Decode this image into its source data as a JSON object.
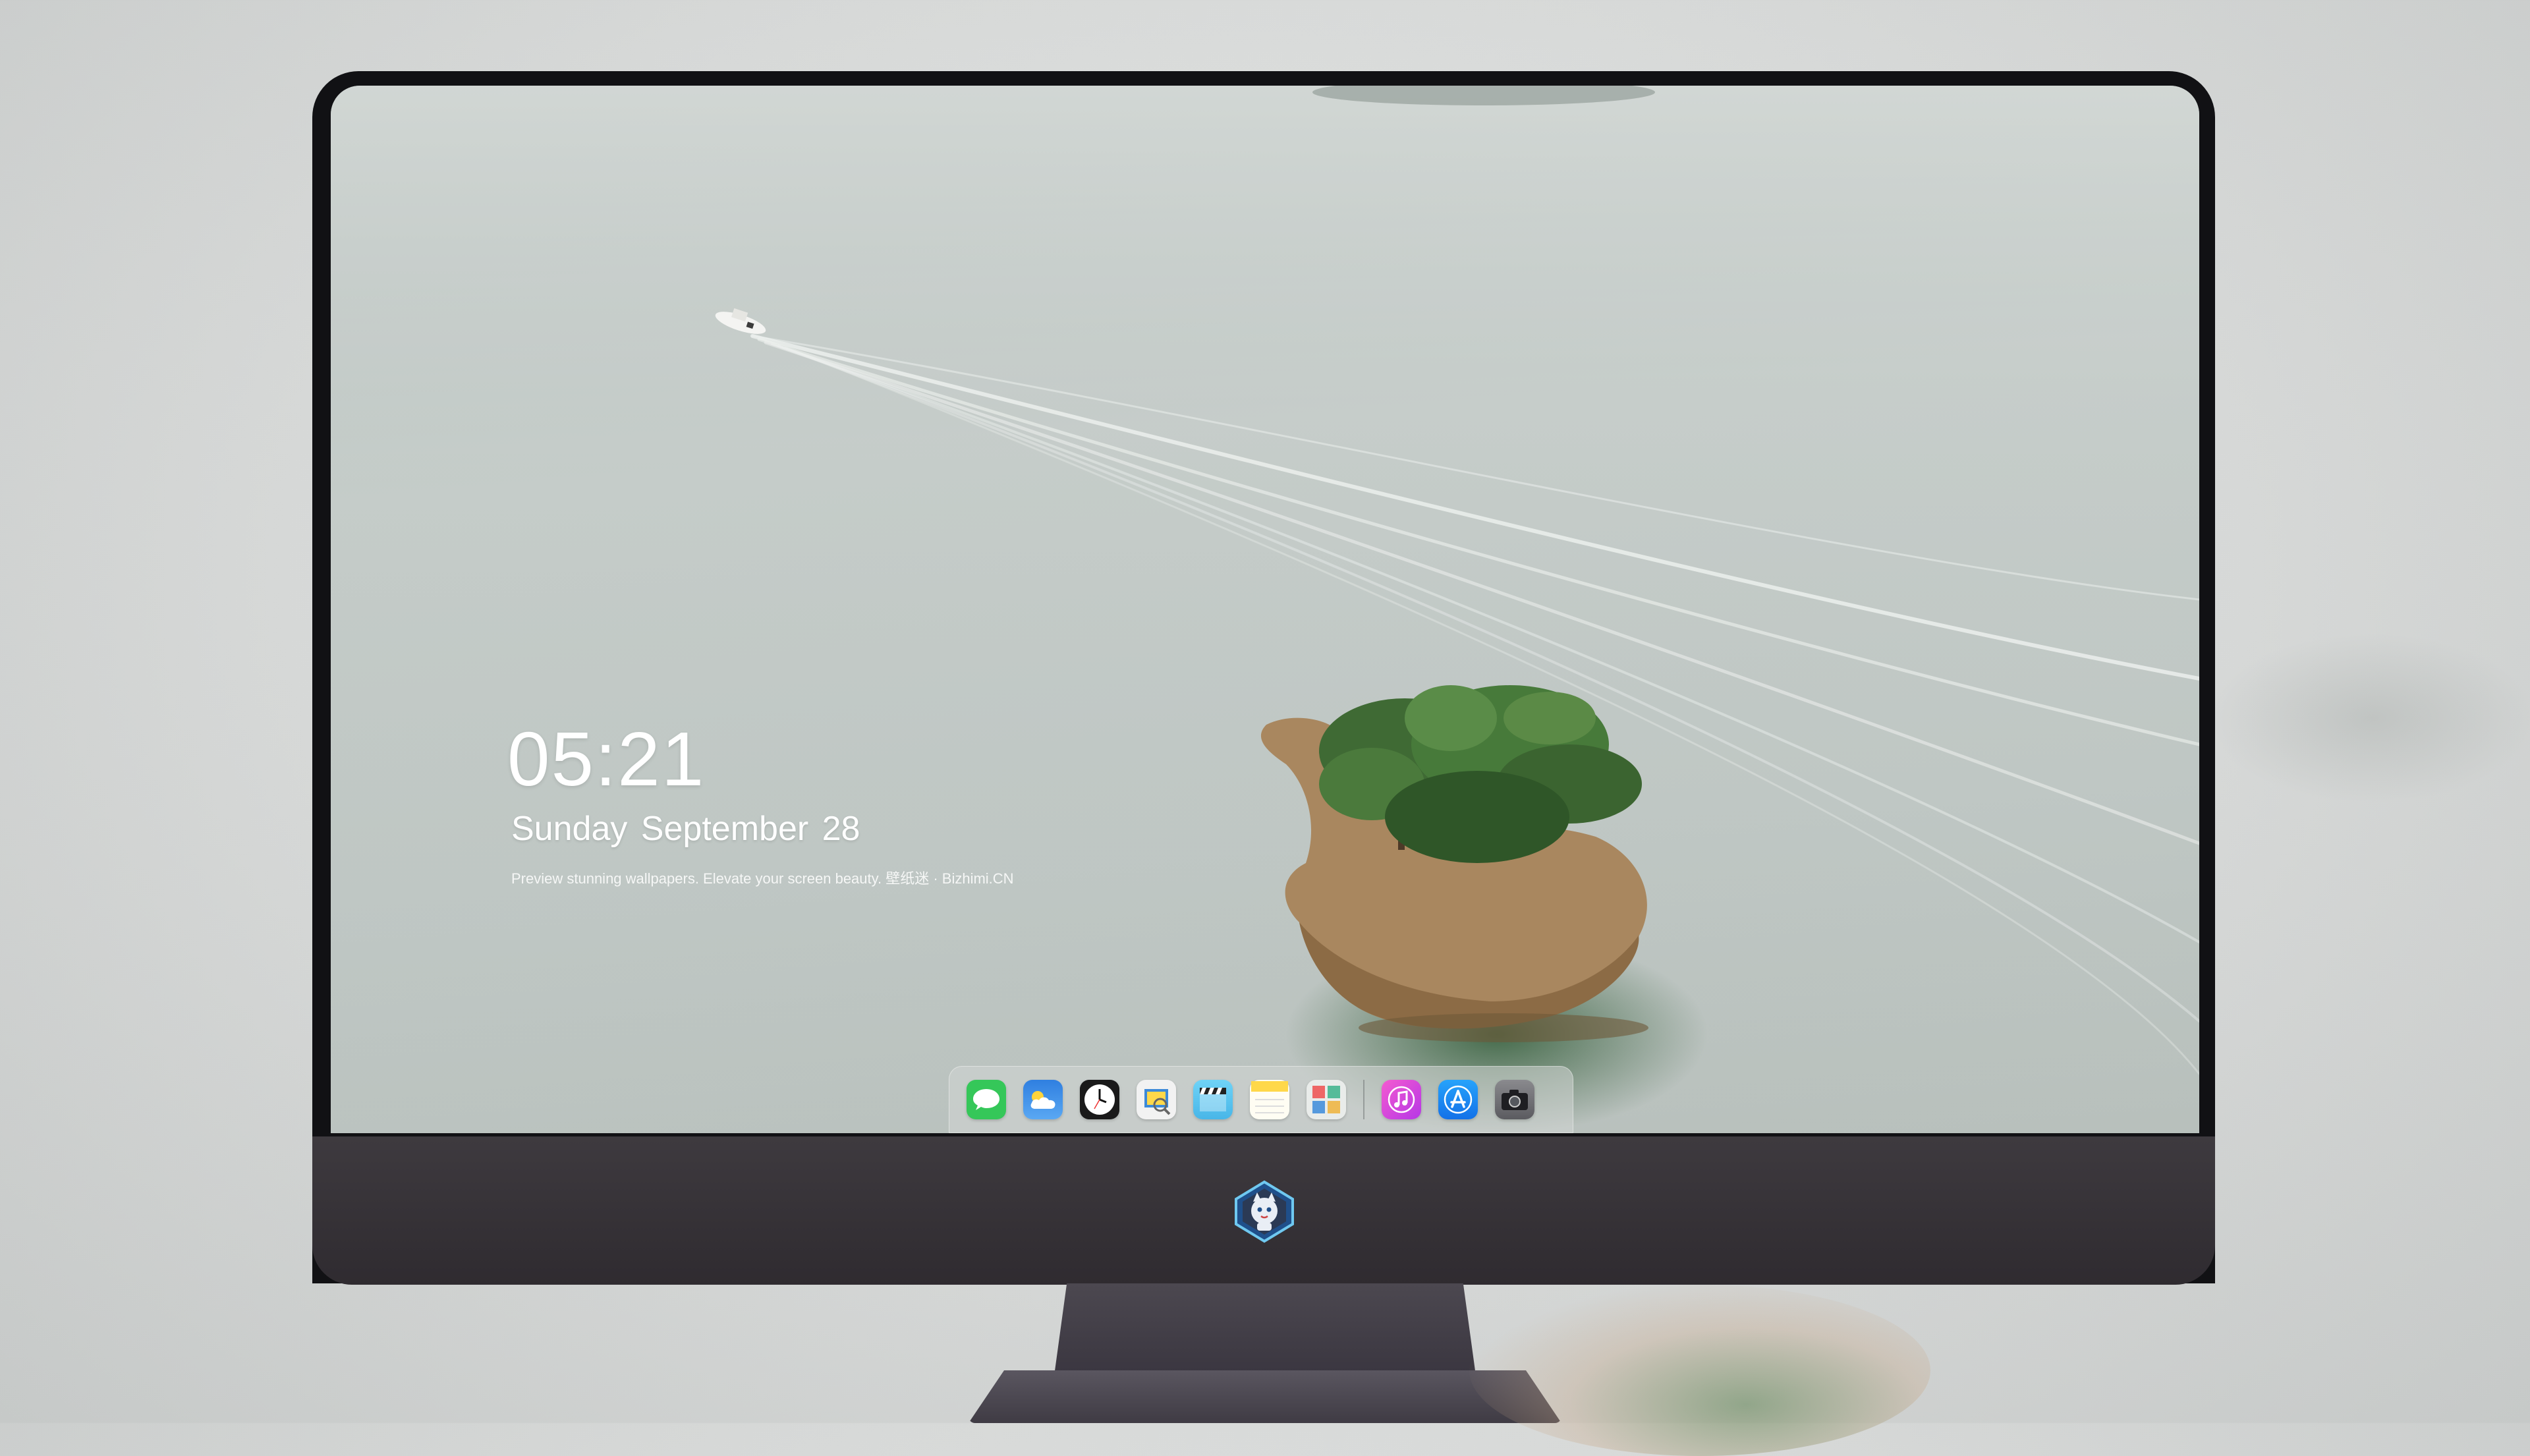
{
  "lockscreen": {
    "time": "05:21",
    "date": "Sunday September  28",
    "tagline": "Preview stunning wallpapers. Elevate your screen beauty. 壁纸迷 · Bizhimi.CN"
  },
  "dock": {
    "apps": [
      {
        "name": "Messages",
        "icon": "messages-icon",
        "color": "#35c759"
      },
      {
        "name": "Weather",
        "icon": "weather-icon",
        "color": "#3b8fe8"
      },
      {
        "name": "Clock",
        "icon": "clock-icon",
        "color": "#1a1a1a"
      },
      {
        "name": "Preview",
        "icon": "preview-icon",
        "color": "#f2f2f2"
      },
      {
        "name": "Clips",
        "icon": "clips-icon",
        "color": "#5ac8fa"
      },
      {
        "name": "Notes",
        "icon": "notes-icon",
        "color": "#ffd84a"
      },
      {
        "name": "Photo Booth",
        "icon": "photo-booth-icon",
        "color": "#e9ecea"
      },
      {
        "name": "iTunes",
        "icon": "music-icon",
        "color": "#e44ad8"
      },
      {
        "name": "App Store",
        "icon": "app-store-icon",
        "color": "#1e90f5"
      },
      {
        "name": "Camera",
        "icon": "camera-icon",
        "color": "#6e6e72"
      }
    ]
  },
  "colors": {
    "bezel": "#111114",
    "chin": "#3a363b",
    "water": "#c1c8c5"
  }
}
